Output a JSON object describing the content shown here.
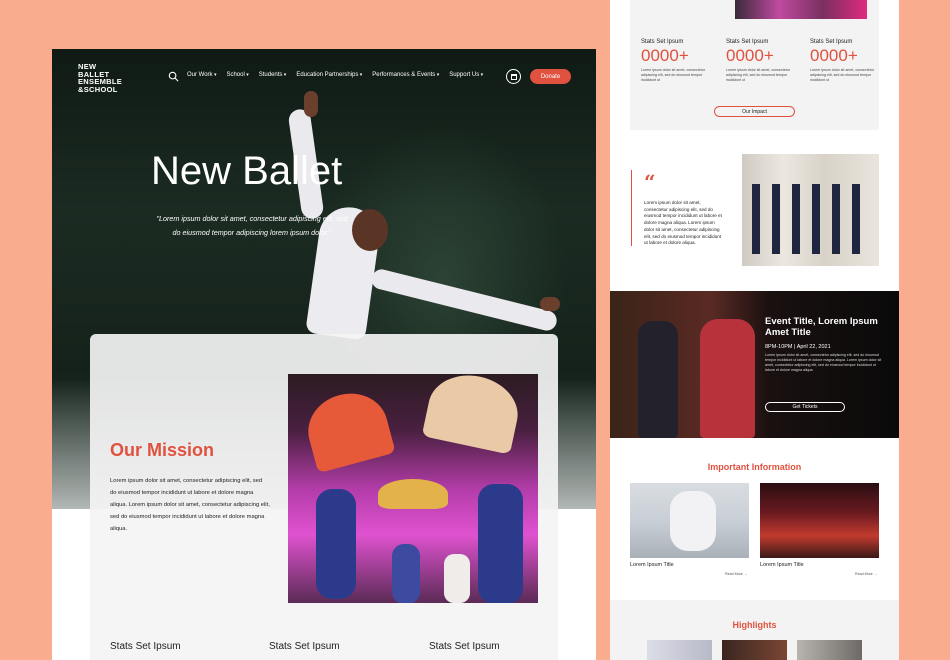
{
  "left": {
    "logo_lines": [
      "NEW",
      "BALLET",
      "ENSEMBLE",
      "&SCHOOL"
    ],
    "nav": [
      "Our Work",
      "School",
      "Students",
      "Education Partnerships",
      "Performances & Events",
      "Support Us"
    ],
    "donate_label": "Donate",
    "hero_title": "New Ballet",
    "hero_quote": "\"Lorem ipsum dolor sit amet, consectetur adipiscing elit, sed do eiusmod tempor adipiscing lorem ipsum dolor.\"",
    "mission_title": "Our Mission",
    "mission_text": "Lorem ipsum dolor sit amet, consectetur adipiscing elit, sed do eiusmod tempor incididunt ut labore et dolore magna aliqua. Lorem ipsum dolor sit amet, consectetur adipiscing elit, sed do eiusmod tempor incididunt ut labore et dolore magna aliqua.",
    "stats_headings": [
      "Stats Set Ipsum",
      "Stats Set Ipsum",
      "Stats Set Ipsum"
    ]
  },
  "right": {
    "stats": [
      {
        "label": "Stats Set Ipsum",
        "value": "0000+",
        "desc": "Lorem ipsum dolor sit amet, consectetur adipiscing elit, sed do eiusmod tempor incididunt ut"
      },
      {
        "label": "Stats Set Ipsum",
        "value": "0000+",
        "desc": "Lorem ipsum dolor sit amet, consectetur adipiscing elit, sed do eiusmod tempor incididunt ut"
      },
      {
        "label": "Stats Set Ipsum",
        "value": "0000+",
        "desc": "Lorem ipsum dolor sit amet, consectetur adipiscing elit, sed do eiusmod tempor incididunt ut"
      }
    ],
    "impact_label": "Our Impact",
    "quote_mark": "“",
    "quote_text": "Lorem ipsum dolor sit amet, consectetur adipiscing elit, sed do eiusmod tempor incididunt ut labore et dolore magna aliqua. Lorem ipsum dolor sit amet, consectetur adipiscing elit, sed do eiusmod tempor incididunt ut labore et dolore aliqua.",
    "event_title": "Event Title, Lorem Ipsum Amet Title",
    "event_datetime": "8PM-10PM  |  April 22, 2021",
    "event_desc": "Lorem ipsum dolor sit amet, consectetur adipiscing elit, sed do eiusmod tempor incididunt ut labore et dolore magna aliqua. Lorem ipsum dolor sit amet, consectetur adipiscing elit, sed do eiusmod tempor incididunt ut labore et dolore magna aliqua.",
    "tickets_label": "Get Tickets",
    "info_heading": "Important Information",
    "info_titles": [
      "Lorem Ipsum Title",
      "Lorem Ipsum Title"
    ],
    "read_more": "Read More →",
    "highlights_heading": "Highlights"
  },
  "colors": {
    "accent": "#e0523f",
    "backdrop": "#f9ad8e"
  }
}
